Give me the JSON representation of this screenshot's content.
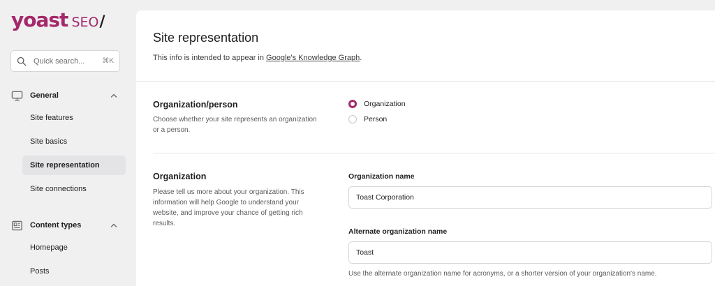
{
  "logo": {
    "main": "yoast",
    "seo": "SEO",
    "slash": "/"
  },
  "search": {
    "placeholder": "Quick search...",
    "shortcut": "⌘K"
  },
  "sidebar": {
    "general": {
      "label": "General",
      "items": [
        "Site features",
        "Site basics",
        "Site representation",
        "Site connections"
      ],
      "active": "Site representation"
    },
    "content_types": {
      "label": "Content types",
      "items": [
        "Homepage",
        "Posts"
      ]
    }
  },
  "page": {
    "title": "Site representation",
    "description_prefix": "This info is intended to appear in ",
    "description_link": "Google's Knowledge Graph",
    "description_suffix": "."
  },
  "org_person": {
    "title": "Organization/person",
    "description": "Choose whether your site represents an organization or a person.",
    "options": [
      {
        "label": "Organization",
        "checked": true
      },
      {
        "label": "Person",
        "checked": false
      }
    ]
  },
  "organization": {
    "title": "Organization",
    "description": "Please tell us more about your organization. This information will help Google to understand your website, and improve your chance of getting rich results.",
    "name_label": "Organization name",
    "name_value": "Toast Corporation",
    "alt_name_label": "Alternate organization name",
    "alt_name_value": "Toast",
    "alt_name_help": "Use the alternate organization name for acronyms, or a shorter version of your organization's name."
  },
  "colors": {
    "brand": "#a4286a",
    "background": "#f0f0f1",
    "panel": "#ffffff"
  }
}
